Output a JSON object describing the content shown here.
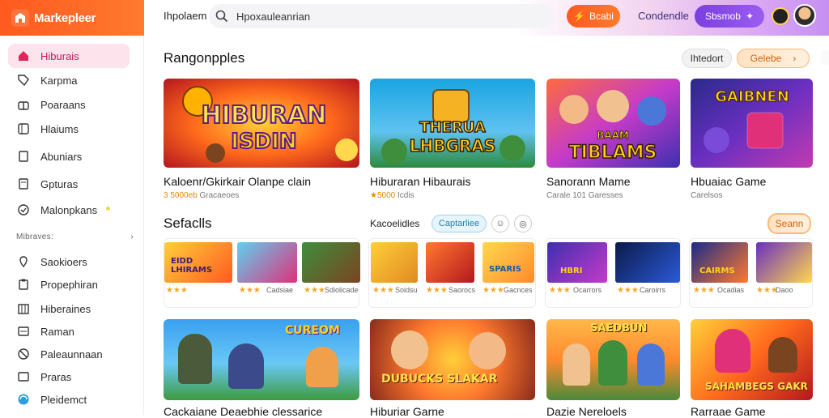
{
  "header": {
    "brand": "Markepleer",
    "search_label": "Ihpolaem",
    "search_value": "Hpoxauleanrian",
    "btn_primary": "Bcabi",
    "link": "Condendle",
    "btn_secondary": "Sbsmob",
    "colors": {
      "brand": "#ff5a1f",
      "accent_purple": "#7b3fe0"
    }
  },
  "sidebar": {
    "items": [
      {
        "label": "Hiburais",
        "icon": "home-icon",
        "active": true
      },
      {
        "label": "Karpma",
        "icon": "tag-icon"
      },
      {
        "label": "Poaraans",
        "icon": "gift-icon"
      },
      {
        "label": "Hlaiums",
        "icon": "grid-icon"
      },
      {
        "label": "Abuniars",
        "icon": "square-icon"
      },
      {
        "label": "Gpturas",
        "icon": "doc-icon"
      },
      {
        "label": "Malonpkans",
        "icon": "check-icon"
      }
    ],
    "section_label": "Mibraves:",
    "section_chevron": "›",
    "items2": [
      {
        "label": "Saokioers",
        "icon": "pin-icon"
      },
      {
        "label": "Propephiran",
        "icon": "clipboard-icon"
      },
      {
        "label": "Hiberaines",
        "icon": "bars-icon"
      },
      {
        "label": "Raman",
        "icon": "list-icon"
      },
      {
        "label": "Paleaunnaan",
        "icon": "slash-circle-icon"
      },
      {
        "label": "Praras",
        "icon": "image-icon"
      },
      {
        "label": "Pleidemct",
        "icon": "globe-icon"
      }
    ]
  },
  "top_section": {
    "title": "Rangonpples",
    "filter_label": "Ihtedort",
    "cta_label": "Gelebe",
    "cards": [
      {
        "title": "Kaloenr/Gkirkair Olanpe clain",
        "sub_prefix": "3  5000eb",
        "sub_rest": " Gracaeoes",
        "art_line1": "HIBURAN",
        "art_line2": "ISDIN"
      },
      {
        "title": "Hiburaran Hibaurais",
        "sub_prefix": "★5000 ",
        "sub_rest": "Icdis",
        "art_line1": "THERUA",
        "art_line2": "LHBGRAS"
      },
      {
        "title": "Sanorann Mame",
        "sub_prefix": "",
        "sub_rest": "Carale  101  Garesses",
        "art_line1": "BAAM",
        "art_line2": "TIBLAMS"
      },
      {
        "title": "Hbuaiac Game",
        "sub_prefix": "",
        "sub_rest": "Carelsos",
        "art_line1": "GAIBNEN",
        "art_line2": ""
      }
    ]
  },
  "mid_section": {
    "title": "Sefaclls",
    "tabs_label": "Kacoelidles",
    "chip_label": "Captarliee",
    "chip2": "☺",
    "chip3": "◎",
    "btn_label": "Seann",
    "groups": [
      {
        "items": [
          {
            "art": "EIDD LHIRAMS",
            "stars": "★★★",
            "text": ""
          },
          {
            "art": "",
            "stars": "★★★",
            "text": "Cadsiae"
          },
          {
            "art": "",
            "stars": "★★★",
            "text": "Sdiolicade"
          }
        ]
      },
      {
        "items": [
          {
            "art": "",
            "stars": "★★★",
            "text": "Soidsu"
          },
          {
            "art": "",
            "stars": "★★★",
            "text": "Saorocs"
          },
          {
            "art": "SPARIS",
            "stars": "★★★",
            "text": "Gacnces"
          }
        ]
      },
      {
        "items": [
          {
            "art": "HBRI",
            "stars": "★★★",
            "text": "Ocarrors"
          },
          {
            "art": "",
            "stars": "★★★",
            "text": "Caroirrs"
          }
        ]
      },
      {
        "items": [
          {
            "art": "CAIRMS",
            "stars": "★★★",
            "text": "Ocadias"
          },
          {
            "art": "",
            "stars": "★★★",
            "text": "Daoo"
          }
        ]
      }
    ]
  },
  "bottom_section": {
    "cards": [
      {
        "title": "Cackaiane Deaebhie clessarice",
        "art": "CUREOM"
      },
      {
        "title": "Hiburiar Garne",
        "art": "DUBUCKS  SLAKAR"
      },
      {
        "title": "Dazie Nereloels",
        "art": "SAEDBUN"
      },
      {
        "title": "Rarraae Game",
        "art": "SAHAMBEGS GAKR"
      }
    ]
  }
}
